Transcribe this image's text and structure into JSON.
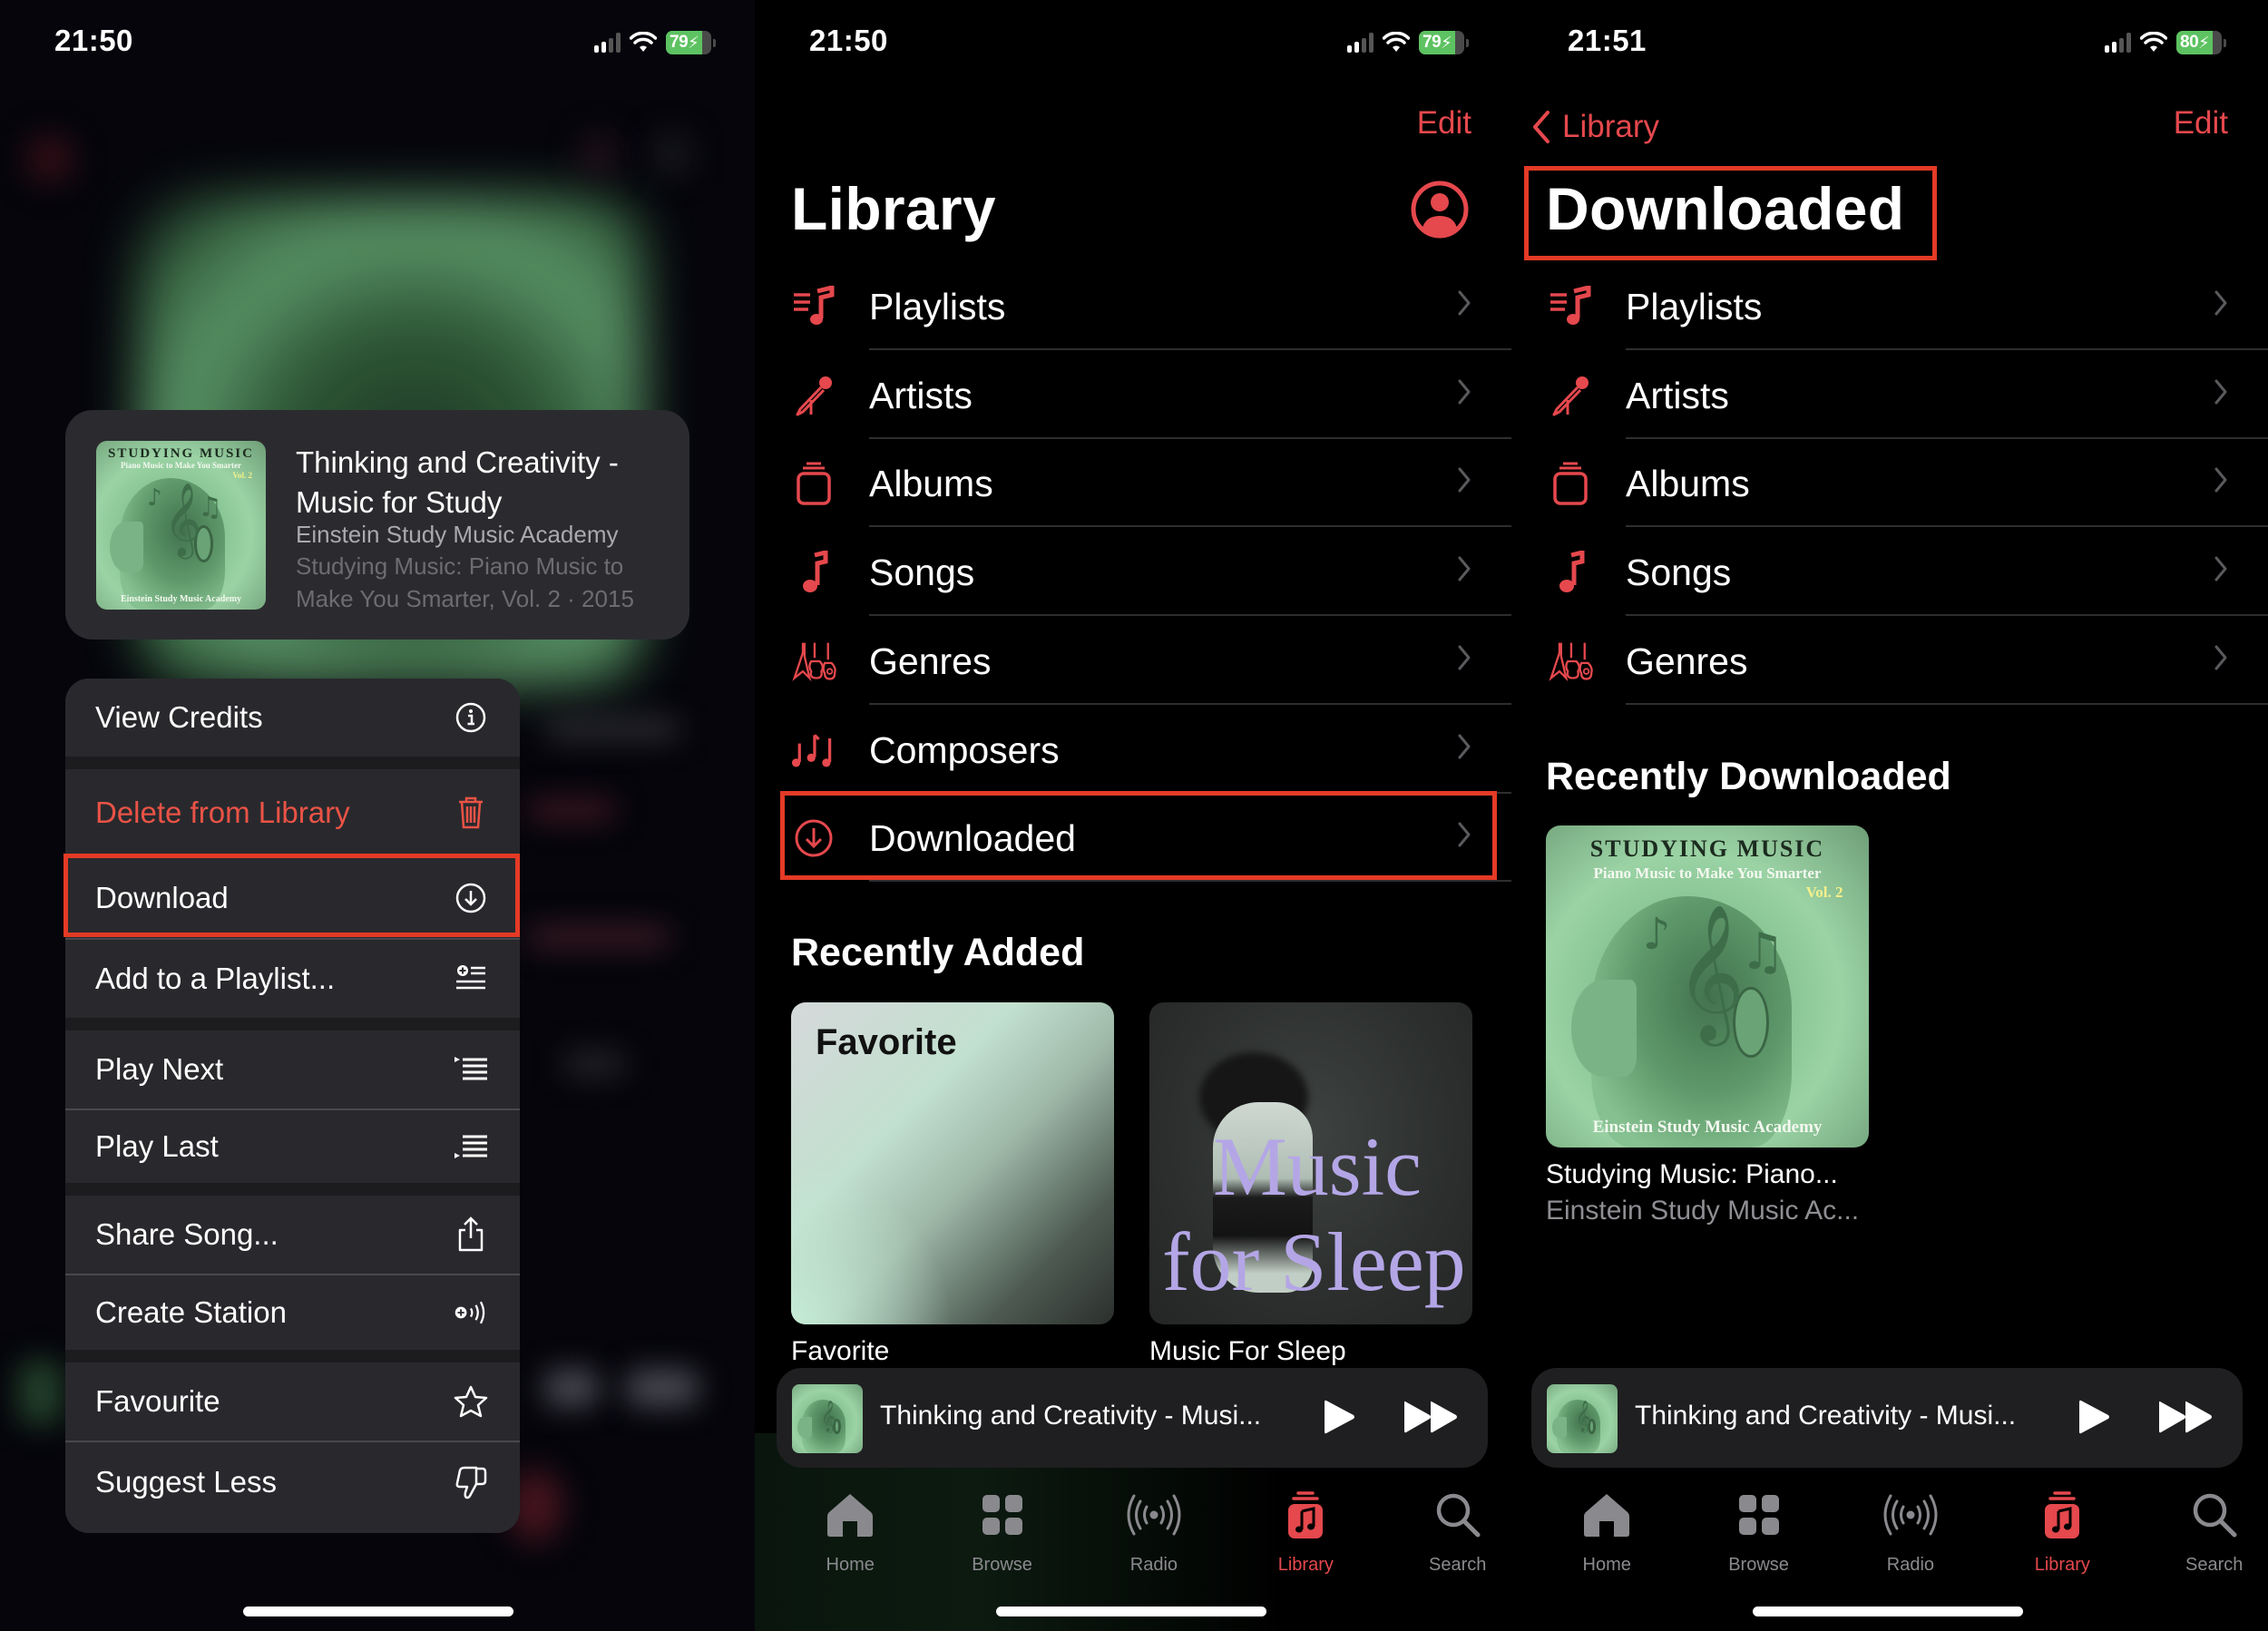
{
  "colors": {
    "accent": "#e5484d",
    "destructive": "#ea5346",
    "highlight_box": "#e43a26",
    "battery_green": "#5dc261"
  },
  "panel1": {
    "status": {
      "time": "21:50",
      "battery": "79"
    },
    "song_card": {
      "art_title": "STUDYING MUSIC",
      "art_subtitle": "Piano Music to Make You Smarter",
      "art_volume": "Vol. 2",
      "art_artist": "Einstein Study Music Academy",
      "title": "Thinking and Creativity - Music for Study",
      "artist": "Einstein Study Music Academy",
      "album": "Studying Music: Piano Music to Make You Smarter, Vol. 2 · 2015"
    },
    "menu": {
      "items": [
        {
          "label": "View Credits",
          "icon": "info-circle-icon"
        },
        {
          "label": "Delete from Library",
          "icon": "trash-icon",
          "destructive": true
        },
        {
          "label": "Download",
          "icon": "download-circle-icon",
          "highlighted": true
        },
        {
          "label": "Add to a Playlist...",
          "icon": "add-to-playlist-icon"
        },
        {
          "label": "Play Next",
          "icon": "play-next-icon"
        },
        {
          "label": "Play Last",
          "icon": "play-last-icon"
        },
        {
          "label": "Share Song...",
          "icon": "share-icon"
        },
        {
          "label": "Create Station",
          "icon": "create-station-icon"
        },
        {
          "label": "Favourite",
          "icon": "star-icon"
        },
        {
          "label": "Suggest Less",
          "icon": "thumbs-down-icon"
        }
      ]
    }
  },
  "panel2": {
    "status": {
      "time": "21:50",
      "battery": "79"
    },
    "edit_label": "Edit",
    "title": "Library",
    "rows": [
      {
        "label": "Playlists",
        "icon": "playlists-icon"
      },
      {
        "label": "Artists",
        "icon": "microphone-icon"
      },
      {
        "label": "Albums",
        "icon": "album-stack-icon"
      },
      {
        "label": "Songs",
        "icon": "music-note-icon"
      },
      {
        "label": "Genres",
        "icon": "guitars-icon"
      },
      {
        "label": "Composers",
        "icon": "composers-notes-icon"
      },
      {
        "label": "Downloaded",
        "icon": "download-circle-icon",
        "highlighted": true
      }
    ],
    "recently_added": {
      "heading": "Recently Added",
      "items": [
        {
          "art_text": "Favorite",
          "label": "Favorite"
        },
        {
          "art_line1": "Music",
          "art_line2": "for Sleep",
          "label": "Music For Sleep"
        }
      ]
    }
  },
  "panel3": {
    "status": {
      "time": "21:51",
      "battery": "80"
    },
    "back_label": "Library",
    "edit_label": "Edit",
    "title": "Downloaded",
    "rows": [
      {
        "label": "Playlists",
        "icon": "playlists-icon"
      },
      {
        "label": "Artists",
        "icon": "microphone-icon"
      },
      {
        "label": "Albums",
        "icon": "album-stack-icon"
      },
      {
        "label": "Songs",
        "icon": "music-note-icon"
      },
      {
        "label": "Genres",
        "icon": "guitars-icon"
      }
    ],
    "recently_downloaded": {
      "heading": "Recently Downloaded",
      "album_title": "Studying Music: Piano...",
      "album_artist": "Einstein Study Music Ac..."
    }
  },
  "mini_player": {
    "title": "Thinking and Creativity - Musi..."
  },
  "tabs": [
    {
      "label": "Home",
      "icon": "home-icon"
    },
    {
      "label": "Browse",
      "icon": "browse-grid-icon"
    },
    {
      "label": "Radio",
      "icon": "radio-broadcast-icon"
    },
    {
      "label": "Library",
      "icon": "library-icon",
      "active": true
    },
    {
      "label": "Search",
      "icon": "search-icon"
    }
  ]
}
